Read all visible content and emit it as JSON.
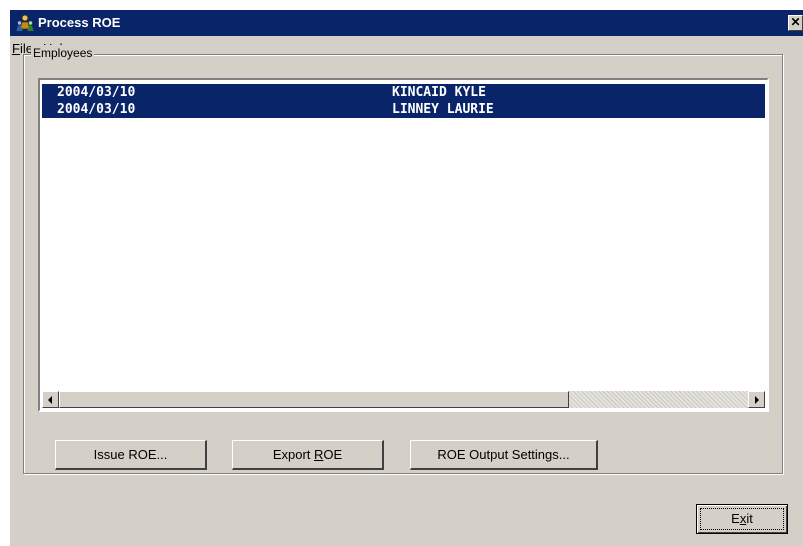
{
  "window": {
    "title": "Process ROE",
    "close_label": "✕"
  },
  "menu": {
    "items": [
      {
        "label": "File",
        "mnemonic": "F"
      },
      {
        "label": "Help",
        "mnemonic": "H"
      }
    ]
  },
  "employees": {
    "group_label": "Employees",
    "rows": [
      {
        "date": "2004/03/10",
        "name": "KINCAID KYLE",
        "selected": true
      },
      {
        "date": "2004/03/10",
        "name": "LINNEY LAURIE",
        "selected": true
      }
    ]
  },
  "buttons": {
    "issue": "Issue ROE...",
    "export": "Export ROE",
    "output_settings": "ROE Output Settings...",
    "exit": "Exit"
  },
  "icons": {
    "app": "app-people-icon",
    "close": "close-icon",
    "scroll_left": "scroll-left-arrow-icon",
    "scroll_right": "scroll-right-arrow-icon"
  },
  "colors": {
    "titlebar": "#0a246a",
    "selection": "#0a246a",
    "face": "#d4d0c8"
  }
}
